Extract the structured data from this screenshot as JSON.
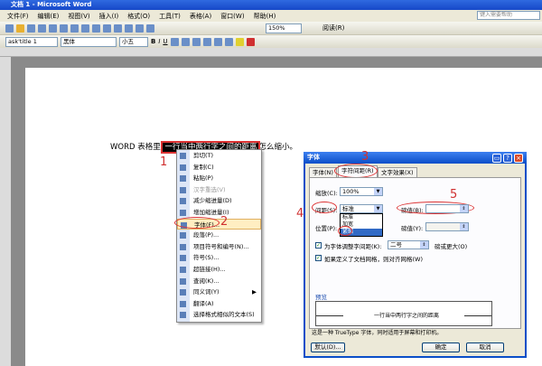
{
  "window": {
    "title": "文档 1 - Microsoft Word"
  },
  "menubar": [
    "文件(F)",
    "编辑(E)",
    "视图(V)",
    "插入(I)",
    "格式(O)",
    "工具(T)",
    "表格(A)",
    "窗口(W)",
    "帮助(H)"
  ],
  "help_placeholder": "键入需要帮助",
  "toolbar": {
    "zoom": "150%",
    "read": "阅读(R)",
    "style": "ask'title 1",
    "font": "黑体",
    "size": "小五"
  },
  "document": {
    "prefix": "WORD 表格里,",
    "selected": "一行当中两行字之间的距离",
    "suffix": "怎么缩小。"
  },
  "context_menu": [
    {
      "label": "剪切(T)"
    },
    {
      "label": "复制(C)"
    },
    {
      "label": "粘贴(P)"
    },
    {
      "label": "汉字重选(V)",
      "disabled": true
    },
    {
      "label": "减少缩进量(D)"
    },
    {
      "label": "增加缩进量(I)"
    },
    {
      "label": "字体(F)...",
      "highlighted": true
    },
    {
      "label": "段落(P)..."
    },
    {
      "label": "项目符号和编号(N)..."
    },
    {
      "label": "符号(S)..."
    },
    {
      "label": "超链接(H)..."
    },
    {
      "label": "查阅(K)..."
    },
    {
      "label": "同义词(Y)",
      "submenu": true
    },
    {
      "label": "翻译(A)"
    },
    {
      "label": "选择格式相似的文本(S)"
    }
  ],
  "dialog": {
    "title": "字体",
    "tabs": [
      "字体(N)",
      "字符间距(R)",
      "文字效果(X)"
    ],
    "scale_label": "缩放(C):",
    "scale_value": "100%",
    "spacing_label": "间距(S):",
    "spacing_value": "标准",
    "spacing_options": [
      "标准",
      "加宽",
      "紧缩"
    ],
    "by_label": "磅值(B):",
    "by_value": "",
    "position_label": "位置(P):",
    "by2_label": "磅值(Y):",
    "kerning_label": "为字体调整字间距(K):",
    "kerning_value": "二号",
    "kerning_suffix": "磅或更大(O)",
    "grid_label": "如果定义了文档网格，则对齐网格(W)",
    "preview_label": "预览",
    "preview_text": "一行当中两行字之间的距离",
    "note": "这是一种 TrueType 字体，同时适用于屏幕和打印机。",
    "default_btn": "默认(D)...",
    "ok_btn": "确定",
    "cancel_btn": "取消"
  },
  "annotations": [
    "1",
    "2",
    "3",
    "4",
    "5"
  ]
}
